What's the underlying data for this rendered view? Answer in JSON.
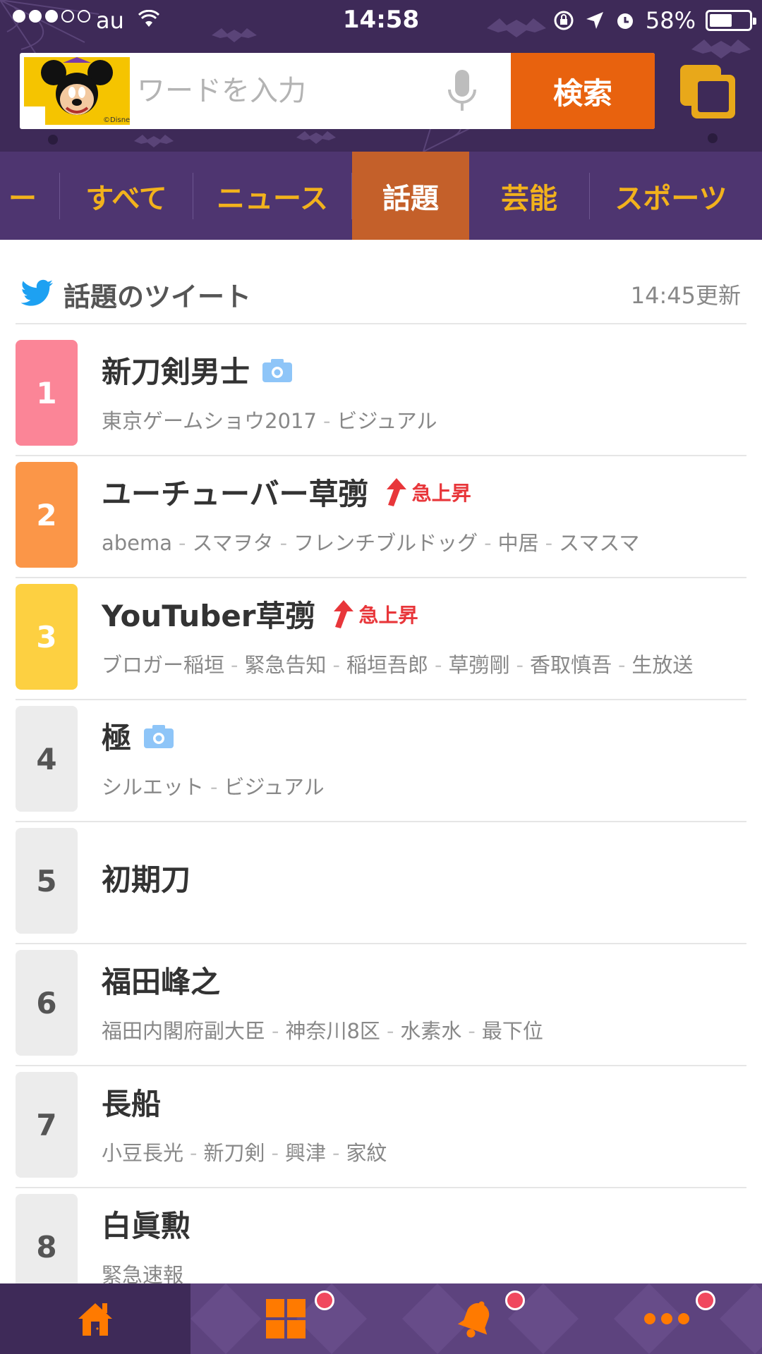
{
  "status_bar": {
    "carrier": "au",
    "time": "14:58",
    "battery": "58%",
    "battery_level": 0.58
  },
  "search": {
    "placeholder": "ワードを入力",
    "button_label": "検索",
    "avatar_credit": "©Disney"
  },
  "tabs": [
    {
      "label": "ー"
    },
    {
      "label": "すべて"
    },
    {
      "label": "ニュース"
    },
    {
      "label": "話題",
      "active": true
    },
    {
      "label": "芸能"
    },
    {
      "label": "スポーツ"
    }
  ],
  "section": {
    "title": "話題のツイート",
    "updated": "14:45更新"
  },
  "ranking": [
    {
      "rank": "1",
      "title": "新刀剣男士",
      "photo": true,
      "rising": false,
      "keywords": [
        "東京ゲームショウ2017",
        "ビジュアル"
      ]
    },
    {
      "rank": "2",
      "title": "ユーチューバー草彅",
      "photo": false,
      "rising": true,
      "keywords": [
        "abema",
        "スマヲタ",
        "フレンチブルドッグ",
        "中居",
        "スマスマ"
      ]
    },
    {
      "rank": "3",
      "title": "YouTuber草彅",
      "photo": false,
      "rising": true,
      "keywords": [
        "ブロガー稲垣",
        "緊急告知",
        "稲垣吾郎",
        "草彅剛",
        "香取慎吾",
        "生放送"
      ]
    },
    {
      "rank": "4",
      "title": "極",
      "photo": true,
      "rising": false,
      "keywords": [
        "シルエット",
        "ビジュアル"
      ]
    },
    {
      "rank": "5",
      "title": "初期刀",
      "photo": false,
      "rising": false,
      "keywords": []
    },
    {
      "rank": "6",
      "title": "福田峰之",
      "photo": false,
      "rising": false,
      "keywords": [
        "福田内閣府副大臣",
        "神奈川8区",
        "水素水",
        "最下位"
      ]
    },
    {
      "rank": "7",
      "title": "長船",
      "photo": false,
      "rising": false,
      "keywords": [
        "小豆長光",
        "新刀剣",
        "興津",
        "家紋"
      ]
    },
    {
      "rank": "8",
      "title": "白眞勲",
      "photo": false,
      "rising": false,
      "keywords": [
        "緊急速報"
      ]
    }
  ],
  "rising_label": "急上昇",
  "bottom_nav": [
    {
      "icon": "home-icon",
      "active": true,
      "badge": false
    },
    {
      "icon": "grid-icon",
      "active": false,
      "badge": true
    },
    {
      "icon": "bell-icon",
      "active": false,
      "badge": true
    },
    {
      "icon": "more-icon",
      "active": false,
      "badge": true
    }
  ],
  "colors": {
    "header_bg": "#3e2a58",
    "tab_bar_bg": "#4e3570",
    "tab_text": "#f2b21c",
    "tab_active_bg": "#c4602a",
    "search_button": "#e8620e",
    "rank1": "#fb8597",
    "rank2": "#fb9648",
    "rank3": "#fdd041",
    "rank_default": "#ececec",
    "rising": "#e8363a",
    "twitter": "#1da1f2",
    "nav_icon": "#ff7a00",
    "badge": "#f0485e"
  }
}
